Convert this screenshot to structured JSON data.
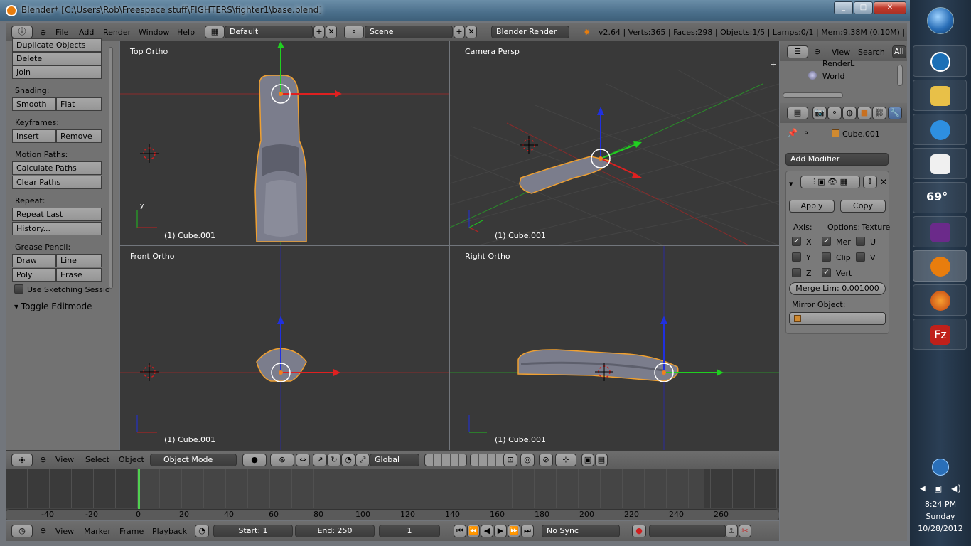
{
  "titlebar": {
    "title": "Blender* [C:\\Users\\Rob\\Freespace stuff\\FIGHTERS\\fighter1\\base.blend]"
  },
  "menu": {
    "items": [
      "File",
      "Add",
      "Render",
      "Window",
      "Help"
    ],
    "layout": "Default",
    "scene": "Scene",
    "engine": "Blender Render",
    "stats": "v2.64 | Verts:365 | Faces:298 | Objects:1/5 | Lamps:0/1 | Mem:9.38M (0.10M) | Cube."
  },
  "toolshelf": {
    "dup": "Duplicate Objects",
    "delete": "Delete",
    "join": "Join",
    "shading": "Shading:",
    "smooth": "Smooth",
    "flat": "Flat",
    "keyframes": "Keyframes:",
    "insert": "Insert",
    "remove": "Remove",
    "motion": "Motion Paths:",
    "calc": "Calculate Paths",
    "clear": "Clear Paths",
    "repeat": "Repeat:",
    "repeat_last": "Repeat Last",
    "history": "History...",
    "grease": "Grease Pencil:",
    "draw": "Draw",
    "line": "Line",
    "poly": "Poly",
    "erase": "Erase",
    "sketch": "Use Sketching Sessio",
    "toggle": "Toggle Editmode"
  },
  "viewports": [
    {
      "label": "Top Ortho",
      "object": "(1) Cube.001"
    },
    {
      "label": "Camera Persp",
      "object": "(1) Cube.001"
    },
    {
      "label": "Front Ortho",
      "object": "(1) Cube.001"
    },
    {
      "label": "Right Ortho",
      "object": "(1) Cube.001"
    }
  ],
  "axis": {
    "x": "x",
    "y": "y",
    "z": "z"
  },
  "viewbar": {
    "view": "View",
    "select": "Select",
    "object": "Object",
    "mode": "Object Mode",
    "orient": "Global"
  },
  "timeline": {
    "ticks": [
      "-40",
      "-20",
      "0",
      "20",
      "40",
      "60",
      "80",
      "100",
      "120",
      "140",
      "160",
      "180",
      "200",
      "220",
      "240",
      "260"
    ],
    "view": "View",
    "marker": "Marker",
    "frame": "Frame",
    "playback": "Playback",
    "start": "Start: 1",
    "end": "End: 250",
    "current": "1",
    "sync": "No Sync"
  },
  "outliner": {
    "view": "View",
    "search": "Search",
    "all": "All",
    "item1": "RenderL",
    "item2": "World"
  },
  "properties": {
    "object": "Cube.001",
    "add_modifier": "Add Modifier",
    "apply": "Apply",
    "copy": "Copy",
    "axis": "Axis:",
    "options": "Options:",
    "texture": "Texture",
    "x": "X",
    "y": "Y",
    "z": "Z",
    "mer": "Mer",
    "clip": "Clip",
    "vert": "Vert",
    "u": "U",
    "v": "V",
    "merge": "Merge Lim: 0.001000",
    "mirror": "Mirror Object:"
  },
  "tray": {
    "time": "8:24 PM",
    "day": "Sunday",
    "date": "10/28/2012",
    "weather": "69°"
  }
}
